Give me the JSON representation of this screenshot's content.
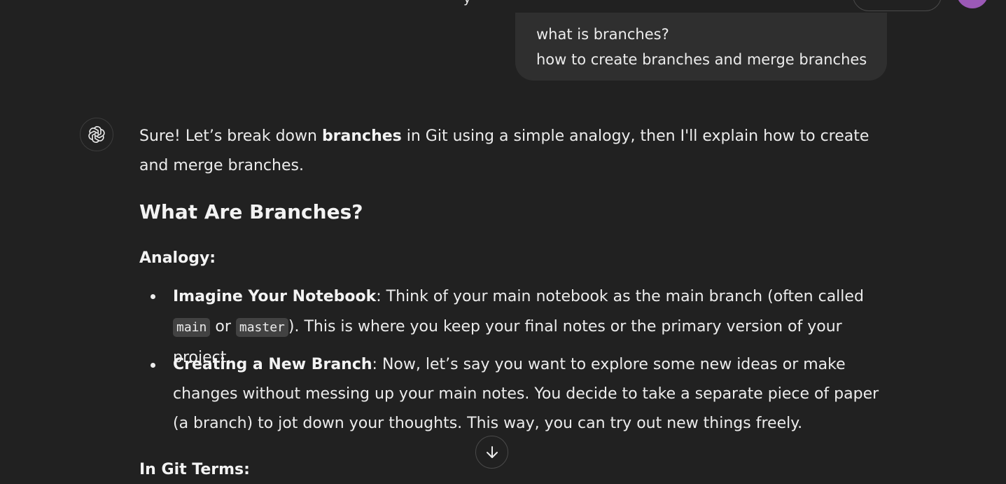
{
  "header": {
    "partial_title": "y"
  },
  "user_message": {
    "lines": [
      "what is branches?",
      "how to create branches and merge branches"
    ]
  },
  "assistant": {
    "intro_part1": "Sure! Let’s break down ",
    "intro_bold": "branches",
    "intro_part2": " in Git using a simple analogy, then I'll explain how to create and merge branches.",
    "heading": "What Are Branches?",
    "analogy_label": "Analogy:",
    "bullets": [
      {
        "bold": "Imagine Your Notebook",
        "text_a": ": Think of your main notebook as the main branch (often called ",
        "code1": "main",
        "text_b": " or ",
        "code2": "master",
        "text_c": "). This is where you keep your final notes or the primary version of your project."
      },
      {
        "bold": "Creating a New Branch",
        "text": ": Now, let’s say you want to explore some new ideas or make changes without messing up your main notes. You decide to take a separate piece of paper (a branch) to jot down your thoughts. This way, you can try out new things freely."
      }
    ],
    "git_terms_label": "In Git Terms:"
  },
  "icons": {
    "assistant_logo": "openai-logo-icon",
    "scroll_down": "arrow-down-icon"
  },
  "colors": {
    "background": "#212121",
    "user_bubble": "#2f2f2f",
    "avatar": "#9b59b6",
    "code_bg": "#424242"
  }
}
